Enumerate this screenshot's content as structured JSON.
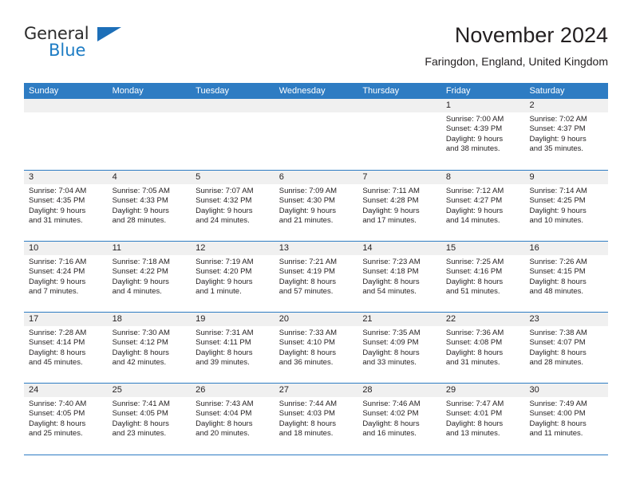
{
  "brand": {
    "name_top": "General",
    "name_bottom": "Blue",
    "triangle_color": "#1d6fb8",
    "text_color": "#1d7cc4"
  },
  "header": {
    "title": "November 2024",
    "subtitle": "Faringdon, England, United Kingdom"
  },
  "theme": {
    "header_blue": "#2e7cc3",
    "daynum_gray": "#f0f0f0",
    "text": "#231f20"
  },
  "weekdays": [
    "Sunday",
    "Monday",
    "Tuesday",
    "Wednesday",
    "Thursday",
    "Friday",
    "Saturday"
  ],
  "weeks": [
    [
      {
        "day": "",
        "empty": true
      },
      {
        "day": "",
        "empty": true
      },
      {
        "day": "",
        "empty": true
      },
      {
        "day": "",
        "empty": true
      },
      {
        "day": "",
        "empty": true
      },
      {
        "day": "1",
        "sunrise": "Sunrise: 7:00 AM",
        "sunset": "Sunset: 4:39 PM",
        "daylight1": "Daylight: 9 hours",
        "daylight2": "and 38 minutes."
      },
      {
        "day": "2",
        "sunrise": "Sunrise: 7:02 AM",
        "sunset": "Sunset: 4:37 PM",
        "daylight1": "Daylight: 9 hours",
        "daylight2": "and 35 minutes."
      }
    ],
    [
      {
        "day": "3",
        "sunrise": "Sunrise: 7:04 AM",
        "sunset": "Sunset: 4:35 PM",
        "daylight1": "Daylight: 9 hours",
        "daylight2": "and 31 minutes."
      },
      {
        "day": "4",
        "sunrise": "Sunrise: 7:05 AM",
        "sunset": "Sunset: 4:33 PM",
        "daylight1": "Daylight: 9 hours",
        "daylight2": "and 28 minutes."
      },
      {
        "day": "5",
        "sunrise": "Sunrise: 7:07 AM",
        "sunset": "Sunset: 4:32 PM",
        "daylight1": "Daylight: 9 hours",
        "daylight2": "and 24 minutes."
      },
      {
        "day": "6",
        "sunrise": "Sunrise: 7:09 AM",
        "sunset": "Sunset: 4:30 PM",
        "daylight1": "Daylight: 9 hours",
        "daylight2": "and 21 minutes."
      },
      {
        "day": "7",
        "sunrise": "Sunrise: 7:11 AM",
        "sunset": "Sunset: 4:28 PM",
        "daylight1": "Daylight: 9 hours",
        "daylight2": "and 17 minutes."
      },
      {
        "day": "8",
        "sunrise": "Sunrise: 7:12 AM",
        "sunset": "Sunset: 4:27 PM",
        "daylight1": "Daylight: 9 hours",
        "daylight2": "and 14 minutes."
      },
      {
        "day": "9",
        "sunrise": "Sunrise: 7:14 AM",
        "sunset": "Sunset: 4:25 PM",
        "daylight1": "Daylight: 9 hours",
        "daylight2": "and 10 minutes."
      }
    ],
    [
      {
        "day": "10",
        "sunrise": "Sunrise: 7:16 AM",
        "sunset": "Sunset: 4:24 PM",
        "daylight1": "Daylight: 9 hours",
        "daylight2": "and 7 minutes."
      },
      {
        "day": "11",
        "sunrise": "Sunrise: 7:18 AM",
        "sunset": "Sunset: 4:22 PM",
        "daylight1": "Daylight: 9 hours",
        "daylight2": "and 4 minutes."
      },
      {
        "day": "12",
        "sunrise": "Sunrise: 7:19 AM",
        "sunset": "Sunset: 4:20 PM",
        "daylight1": "Daylight: 9 hours",
        "daylight2": "and 1 minute."
      },
      {
        "day": "13",
        "sunrise": "Sunrise: 7:21 AM",
        "sunset": "Sunset: 4:19 PM",
        "daylight1": "Daylight: 8 hours",
        "daylight2": "and 57 minutes."
      },
      {
        "day": "14",
        "sunrise": "Sunrise: 7:23 AM",
        "sunset": "Sunset: 4:18 PM",
        "daylight1": "Daylight: 8 hours",
        "daylight2": "and 54 minutes."
      },
      {
        "day": "15",
        "sunrise": "Sunrise: 7:25 AM",
        "sunset": "Sunset: 4:16 PM",
        "daylight1": "Daylight: 8 hours",
        "daylight2": "and 51 minutes."
      },
      {
        "day": "16",
        "sunrise": "Sunrise: 7:26 AM",
        "sunset": "Sunset: 4:15 PM",
        "daylight1": "Daylight: 8 hours",
        "daylight2": "and 48 minutes."
      }
    ],
    [
      {
        "day": "17",
        "sunrise": "Sunrise: 7:28 AM",
        "sunset": "Sunset: 4:14 PM",
        "daylight1": "Daylight: 8 hours",
        "daylight2": "and 45 minutes."
      },
      {
        "day": "18",
        "sunrise": "Sunrise: 7:30 AM",
        "sunset": "Sunset: 4:12 PM",
        "daylight1": "Daylight: 8 hours",
        "daylight2": "and 42 minutes."
      },
      {
        "day": "19",
        "sunrise": "Sunrise: 7:31 AM",
        "sunset": "Sunset: 4:11 PM",
        "daylight1": "Daylight: 8 hours",
        "daylight2": "and 39 minutes."
      },
      {
        "day": "20",
        "sunrise": "Sunrise: 7:33 AM",
        "sunset": "Sunset: 4:10 PM",
        "daylight1": "Daylight: 8 hours",
        "daylight2": "and 36 minutes."
      },
      {
        "day": "21",
        "sunrise": "Sunrise: 7:35 AM",
        "sunset": "Sunset: 4:09 PM",
        "daylight1": "Daylight: 8 hours",
        "daylight2": "and 33 minutes."
      },
      {
        "day": "22",
        "sunrise": "Sunrise: 7:36 AM",
        "sunset": "Sunset: 4:08 PM",
        "daylight1": "Daylight: 8 hours",
        "daylight2": "and 31 minutes."
      },
      {
        "day": "23",
        "sunrise": "Sunrise: 7:38 AM",
        "sunset": "Sunset: 4:07 PM",
        "daylight1": "Daylight: 8 hours",
        "daylight2": "and 28 minutes."
      }
    ],
    [
      {
        "day": "24",
        "sunrise": "Sunrise: 7:40 AM",
        "sunset": "Sunset: 4:05 PM",
        "daylight1": "Daylight: 8 hours",
        "daylight2": "and 25 minutes."
      },
      {
        "day": "25",
        "sunrise": "Sunrise: 7:41 AM",
        "sunset": "Sunset: 4:05 PM",
        "daylight1": "Daylight: 8 hours",
        "daylight2": "and 23 minutes."
      },
      {
        "day": "26",
        "sunrise": "Sunrise: 7:43 AM",
        "sunset": "Sunset: 4:04 PM",
        "daylight1": "Daylight: 8 hours",
        "daylight2": "and 20 minutes."
      },
      {
        "day": "27",
        "sunrise": "Sunrise: 7:44 AM",
        "sunset": "Sunset: 4:03 PM",
        "daylight1": "Daylight: 8 hours",
        "daylight2": "and 18 minutes."
      },
      {
        "day": "28",
        "sunrise": "Sunrise: 7:46 AM",
        "sunset": "Sunset: 4:02 PM",
        "daylight1": "Daylight: 8 hours",
        "daylight2": "and 16 minutes."
      },
      {
        "day": "29",
        "sunrise": "Sunrise: 7:47 AM",
        "sunset": "Sunset: 4:01 PM",
        "daylight1": "Daylight: 8 hours",
        "daylight2": "and 13 minutes."
      },
      {
        "day": "30",
        "sunrise": "Sunrise: 7:49 AM",
        "sunset": "Sunset: 4:00 PM",
        "daylight1": "Daylight: 8 hours",
        "daylight2": "and 11 minutes."
      }
    ]
  ]
}
